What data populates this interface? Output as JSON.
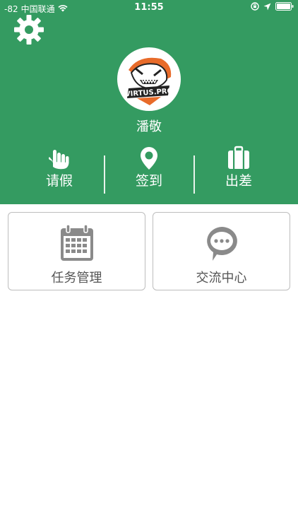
{
  "status_bar": {
    "signal": "-82",
    "carrier": "中国联通",
    "time": "11:55"
  },
  "header": {
    "user_name": "潘敬",
    "avatar_text": "VIRTUS.PRO",
    "actions": [
      {
        "label": "请假",
        "icon": "hand-icon"
      },
      {
        "label": "签到",
        "icon": "location-pin-icon"
      },
      {
        "label": "出差",
        "icon": "luggage-icon"
      }
    ]
  },
  "cards": [
    {
      "label": "任务管理",
      "icon": "calendar-icon"
    },
    {
      "label": "交流中心",
      "icon": "chat-bubble-icon"
    }
  ],
  "colors": {
    "brand_green": "#349b61",
    "card_border": "#bdbdbd",
    "icon_gray": "#8a8a8a"
  }
}
